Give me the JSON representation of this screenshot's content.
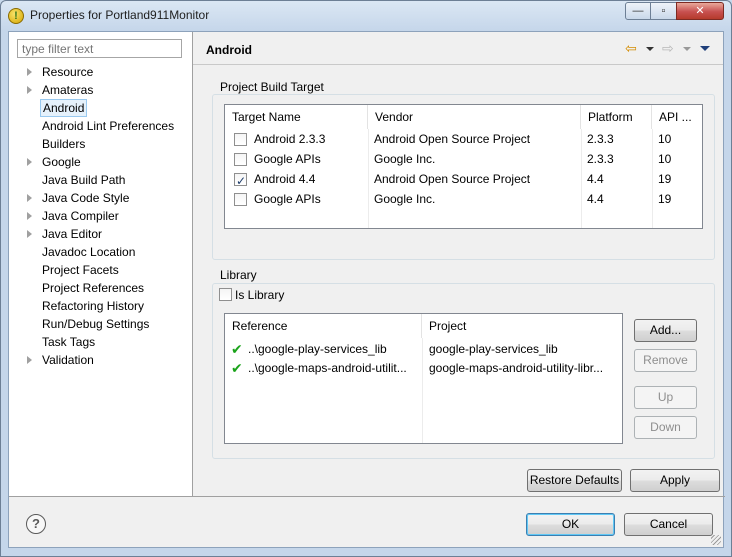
{
  "window": {
    "title": "Properties for Portland911Monitor",
    "app_icon_glyph": "!"
  },
  "titlebar_buttons": {
    "minimize": "—",
    "maximize": "▫",
    "close": "✕"
  },
  "filter": {
    "placeholder": "type filter text"
  },
  "tree": [
    {
      "label": "Resource",
      "expandable": true
    },
    {
      "label": "Amateras",
      "expandable": true
    },
    {
      "label": "Android",
      "expandable": false,
      "selected": true
    },
    {
      "label": "Android Lint Preferences",
      "expandable": false
    },
    {
      "label": "Builders",
      "expandable": false
    },
    {
      "label": "Google",
      "expandable": true
    },
    {
      "label": "Java Build Path",
      "expandable": false
    },
    {
      "label": "Java Code Style",
      "expandable": true
    },
    {
      "label": "Java Compiler",
      "expandable": true
    },
    {
      "label": "Java Editor",
      "expandable": true
    },
    {
      "label": "Javadoc Location",
      "expandable": false
    },
    {
      "label": "Project Facets",
      "expandable": false
    },
    {
      "label": "Project References",
      "expandable": false
    },
    {
      "label": "Refactoring History",
      "expandable": false
    },
    {
      "label": "Run/Debug Settings",
      "expandable": false
    },
    {
      "label": "Task Tags",
      "expandable": false
    },
    {
      "label": "Validation",
      "expandable": true
    }
  ],
  "page": {
    "title": "Android"
  },
  "nav": {
    "back_glyph": "⇦",
    "forward_glyph": "⇨"
  },
  "build_target": {
    "group_label": "Project Build Target",
    "columns": [
      "Target Name",
      "Vendor",
      "Platform",
      "API ..."
    ],
    "rows": [
      {
        "checked": false,
        "name": "Android 2.3.3",
        "vendor": "Android Open Source Project",
        "platform": "2.3.3",
        "api": "10"
      },
      {
        "checked": false,
        "name": "Google APIs",
        "vendor": "Google Inc.",
        "platform": "2.3.3",
        "api": "10"
      },
      {
        "checked": true,
        "name": "Android 4.4",
        "vendor": "Android Open Source Project",
        "platform": "4.4",
        "api": "19"
      },
      {
        "checked": false,
        "name": "Google APIs",
        "vendor": "Google Inc.",
        "platform": "4.4",
        "api": "19"
      }
    ]
  },
  "library": {
    "group_label": "Library",
    "is_library_label": "Is Library",
    "is_library_checked": false,
    "columns": [
      "Reference",
      "Project"
    ],
    "rows": [
      {
        "status_glyph": "✔",
        "reference": "..\\google-play-services_lib",
        "project": "google-play-services_lib"
      },
      {
        "status_glyph": "✔",
        "reference": "..\\google-maps-android-utilit...",
        "project": "google-maps-android-utility-libr..."
      }
    ],
    "buttons": {
      "add": "Add...",
      "remove": "Remove",
      "up": "Up",
      "down": "Down"
    }
  },
  "actions": {
    "restore_defaults": "Restore Defaults",
    "apply": "Apply"
  },
  "footer": {
    "help_glyph": "?",
    "ok": "OK",
    "cancel": "Cancel"
  }
}
